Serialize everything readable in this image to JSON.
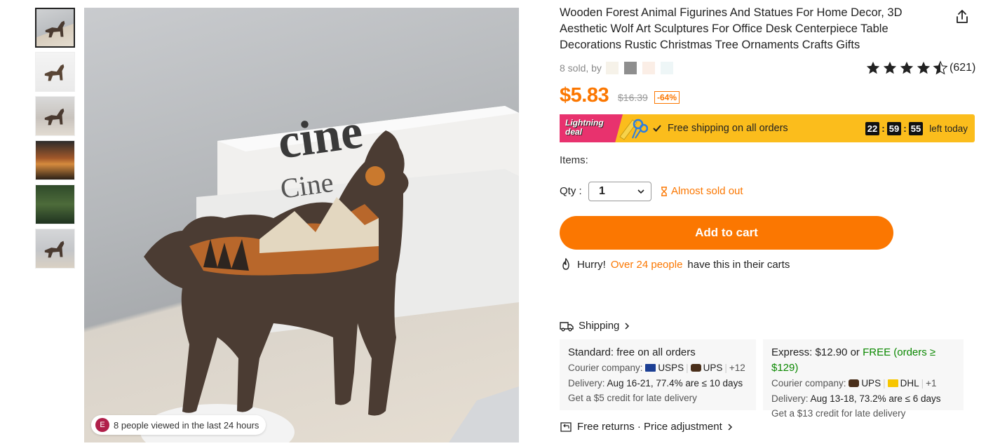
{
  "product": {
    "title": "Wooden Forest Animal Figurines And Statues For Home Decor, 3D Aesthetic Wolf Art Sculptures For Office Desk Centerpiece Table Decorations Rustic Christmas Tree Ornaments Crafts Gifts",
    "sold_text": "8 sold, by",
    "rating_count": "(621)",
    "rating_stars": 4.5,
    "price": "$5.83",
    "old_price": "$16.39",
    "discount": "-64%"
  },
  "gallery": {
    "viewed_avatar": "E",
    "viewed_text": "8 people viewed in the last 24 hours"
  },
  "deal": {
    "badge": "Lightning deal",
    "free_shipping": "Free shipping on all orders",
    "hours": "22",
    "minutes": "59",
    "seconds": "55",
    "left_today": "left today"
  },
  "options": {
    "items_label": "Items:",
    "qty_label": "Qty :",
    "qty_value": "1",
    "stock_status": "Almost sold out"
  },
  "cart": {
    "button": "Add to cart",
    "hurry": "Hurry!",
    "hurry_highlight": "Over 24 people",
    "hurry_tail": "have this in their carts"
  },
  "shipping": {
    "heading": "Shipping",
    "standard": {
      "title": "Standard: free on all orders",
      "courier_label": "Courier company:",
      "courier1": "USPS",
      "courier2": "UPS",
      "more": "+12",
      "delivery_label": "Delivery:",
      "delivery": "Aug 16-21, 77.4% are ≤ 10 days",
      "credit": "Get a $5 credit for late delivery"
    },
    "express": {
      "title_prefix": "Express: $12.90 or",
      "title_free": "FREE (orders ≥ $129)",
      "courier_label": "Courier company:",
      "courier1": "UPS",
      "courier2": "DHL",
      "more": "+1",
      "delivery_label": "Delivery:",
      "delivery": "Aug 13-18, 73.2% are ≤ 6 days",
      "credit": "Get a $13 credit for late delivery"
    },
    "returns": "Free returns · Price adjustment"
  },
  "colors": {
    "accent": "#fb7701",
    "deal_bar": "#fbbd1c",
    "deal_badge": "#e8326e",
    "green": "#0a8800"
  }
}
